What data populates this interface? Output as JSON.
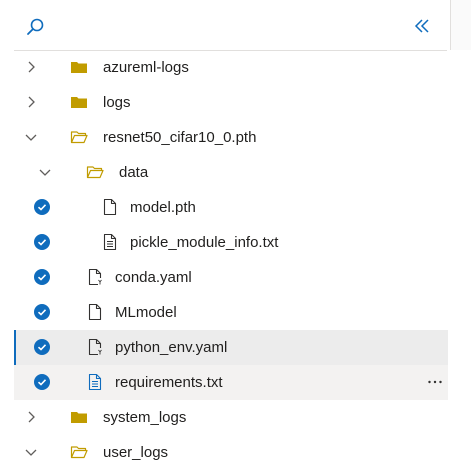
{
  "colors": {
    "accent": "#0f6cbd",
    "folder": "#c19c00",
    "selected_bg": "#ececec"
  },
  "toolbar": {
    "search_icon": "search-icon",
    "collapse_icon": "double-chevron-left-icon"
  },
  "tree": [
    {
      "label": "azureml-logs",
      "type": "folder",
      "expanded": false,
      "checked": false
    },
    {
      "label": "logs",
      "type": "folder",
      "expanded": false,
      "checked": false
    },
    {
      "label": "resnet50_cifar10_0.pth",
      "type": "folder",
      "expanded": true,
      "checked": false
    },
    {
      "label": "data",
      "type": "folder",
      "expanded": true,
      "checked": false
    },
    {
      "label": "model.pth",
      "type": "file",
      "checked": true
    },
    {
      "label": "pickle_module_info.txt",
      "type": "text-file",
      "checked": true
    },
    {
      "label": "conda.yaml",
      "type": "yaml-file",
      "checked": true
    },
    {
      "label": "MLmodel",
      "type": "file",
      "checked": true
    },
    {
      "label": "python_env.yaml",
      "type": "yaml-file",
      "checked": true,
      "selected": true
    },
    {
      "label": "requirements.txt",
      "type": "text-file",
      "checked": true,
      "hovered": true
    },
    {
      "label": "system_logs",
      "type": "folder",
      "expanded": false,
      "checked": false
    },
    {
      "label": "user_logs",
      "type": "folder",
      "expanded": true,
      "checked": false
    }
  ]
}
